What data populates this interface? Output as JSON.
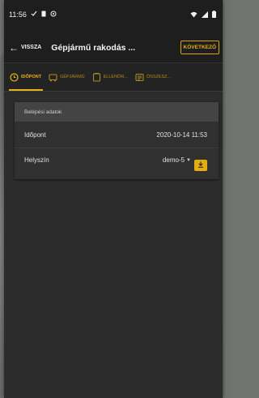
{
  "status_bar": {
    "time": "11:56",
    "icons_left": [
      "check-icon",
      "sim-card-icon",
      "data-saver-icon"
    ],
    "icons_right": [
      "wifi-icon",
      "signal-icon",
      "battery-icon"
    ]
  },
  "app_bar": {
    "back_label": "VISSZA",
    "title": "Gépjármű rakodás ...",
    "next_label": "KÖVETKEZŐ"
  },
  "tabs": [
    {
      "label": "IDŐPONT",
      "icon": "clock-icon",
      "active": true
    },
    {
      "label": "GÉPJÁRMŰ",
      "icon": "truck-icon",
      "active": false
    },
    {
      "label": "ELLENŐR...",
      "icon": "checklist-icon",
      "active": false
    },
    {
      "label": "ÖSSZESZ...",
      "icon": "summary-icon",
      "active": false
    }
  ],
  "card": {
    "header": "Belépési adatok",
    "time_label": "Időpont",
    "time_value": "2020-10-14 11:53",
    "location_label": "Helyszín",
    "location_value": "demo-5"
  },
  "colors": {
    "accent": "#e8b318",
    "background": "#2a2a2a",
    "card_header": "#444444"
  }
}
